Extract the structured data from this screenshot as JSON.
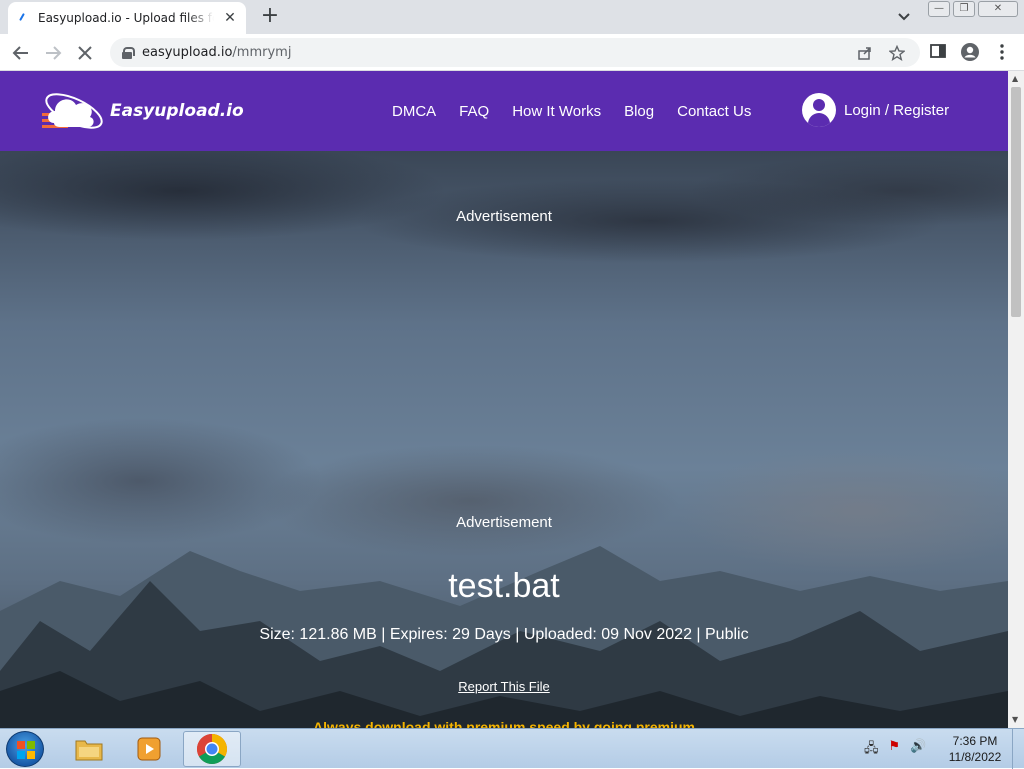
{
  "browser": {
    "tab_title": "Easyupload.io - Upload files for free",
    "tab_close": "✕",
    "new_tab": "+",
    "url_host": "easyupload.io",
    "url_path": "/mmrymj",
    "min": "—",
    "max": "❐",
    "close": "✕"
  },
  "site": {
    "logo_text": "Easyupload.io",
    "nav": [
      "DMCA",
      "FAQ",
      "How It Works",
      "Blog",
      "Contact Us"
    ],
    "login": "Login / Register"
  },
  "page": {
    "ad_label_1": "Advertisement",
    "ad_label_2": "Advertisement",
    "file_name": "test.bat",
    "file_meta": "Size: 121.86 MB | Expires: 29 Days | Uploaded: 09 Nov 2022 | Public",
    "report_link": "Report This File",
    "premium_text": "Always download with premium speed by going premium"
  },
  "taskbar": {
    "time": "7:36 PM",
    "date": "11/8/2022"
  },
  "colors": {
    "header_bg": "#5b2cb0",
    "premium_text": "#f5b400"
  }
}
